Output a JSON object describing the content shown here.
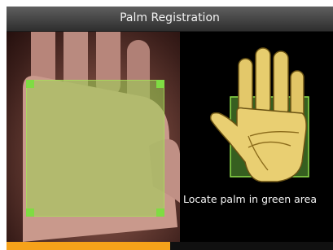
{
  "header": {
    "title": "Palm Registration"
  },
  "instruction": {
    "text": "Locate palm in green area"
  },
  "progress": {
    "fraction": 0.5
  },
  "colors": {
    "guide_green": "#9ed656",
    "progress_orange": "#f6a21a",
    "title_bar": "#4a4a4a"
  },
  "icons": {
    "camera_content": "palm-photo",
    "guide": "palm-illustration-icon"
  }
}
